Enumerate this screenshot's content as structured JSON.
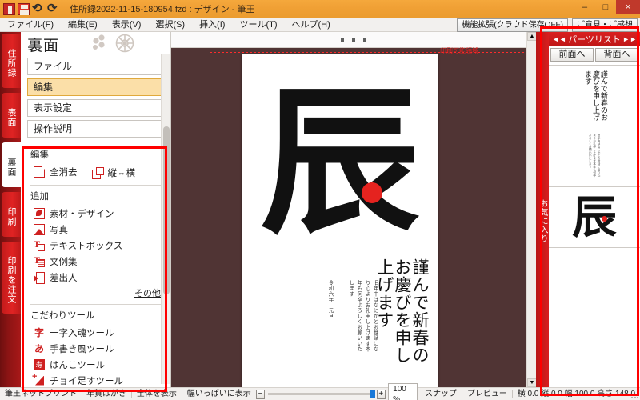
{
  "window": {
    "title": "住所録2022-11-15-180954.fzd : デザイン - 筆王",
    "icons": [
      "document-icon",
      "save-icon",
      "undo-icon",
      "redo-icon"
    ],
    "controls": {
      "minimize": "–",
      "maximize": "□",
      "close": "×"
    }
  },
  "menubar": {
    "items": [
      {
        "label": "ファイル(F)"
      },
      {
        "label": "編集(E)"
      },
      {
        "label": "表示(V)"
      },
      {
        "label": "選択(S)"
      },
      {
        "label": "挿入(I)"
      },
      {
        "label": "ツール(T)"
      },
      {
        "label": "ヘルプ(H)"
      }
    ],
    "right_buttons": [
      {
        "label": "機能拡張(クラウド保存OFF)"
      },
      {
        "label": "ご意見・ご感想"
      }
    ]
  },
  "rail": {
    "tabs": [
      {
        "label": "住所録",
        "active": false
      },
      {
        "label": "表面",
        "active": false
      },
      {
        "label": "裏面",
        "active": true
      },
      {
        "label": "印刷",
        "active": false
      },
      {
        "label": "印刷を注文",
        "active": false
      }
    ]
  },
  "left_panel": {
    "title": "裏面",
    "decoration": "plum-blossom-icon",
    "nav": [
      {
        "label": "ファイル",
        "active": false
      },
      {
        "label": "編集",
        "active": true
      },
      {
        "label": "表示設定",
        "active": false
      },
      {
        "label": "操作説明",
        "active": false
      }
    ],
    "sections": [
      {
        "title": "編集",
        "inline_tools": [
          {
            "label": "全消去",
            "icon": "erase-page-icon"
          },
          {
            "label": "縦⇔横",
            "icon": "flip-orientation-icon"
          }
        ]
      },
      {
        "title": "追加",
        "tools": [
          {
            "label": "素材・デザイン",
            "icon": "material-design-icon"
          },
          {
            "label": "写真",
            "icon": "photo-icon"
          },
          {
            "label": "テキストボックス",
            "icon": "textbox-icon"
          },
          {
            "label": "文例集",
            "icon": "text-sample-icon"
          },
          {
            "label": "差出人",
            "icon": "sender-icon"
          }
        ],
        "more_link": "その他"
      },
      {
        "title": "こだわりツール",
        "tools": [
          {
            "label": "一字入魂ツール",
            "icon": "single-char-tool-icon",
            "glyph": "字"
          },
          {
            "label": "手書き風ツール",
            "icon": "handwriting-tool-icon",
            "glyph": "あ"
          },
          {
            "label": "はんこツール",
            "icon": "stamp-tool-icon",
            "glyph": "寿"
          },
          {
            "label": "チョイ足すツール",
            "icon": "add-a-bit-tool-icon",
            "glyph": "+"
          }
        ]
      }
    ]
  },
  "canvas": {
    "printable_area_label": "印刷可能領域",
    "card": {
      "big_character": "辰",
      "greeting": "謹んで新春のお慶びを申し上げます",
      "body_text": "旧年中はなにかとお世話になり心よりお礼申し上げます本年も何卒よろしくお願いいたします",
      "date_text": "令和六年　元旦"
    }
  },
  "right_panel": {
    "favorites_label": "お気に入り",
    "title": "パーツリスト",
    "collapse_left_icon": "chevron-double-left-icon",
    "collapse_right_icon": "chevron-double-right-icon",
    "buttons": [
      {
        "label": "前面へ"
      },
      {
        "label": "背面へ"
      }
    ],
    "parts": [
      {
        "type": "text",
        "preview": "謹んで新春のお慶びを申し上げます"
      },
      {
        "type": "text",
        "preview": "旧年中はなにかとお世話になり心よりお礼申し上げます本年も何卒よろしくお願いいたします"
      },
      {
        "type": "image",
        "preview": "辰"
      },
      {
        "type": "empty",
        "preview": ""
      }
    ]
  },
  "statusbar": {
    "left_items": [
      "筆王ネットプリント",
      "年賀はがき"
    ],
    "view_items": [
      "全体を表示",
      "幅いっぱいに表示"
    ],
    "zoom_out": "−",
    "zoom_in": "+",
    "zoom_level": "100 %",
    "snap_label": "スナップ",
    "preview_label": "プレビュー",
    "coordinates": "横 0.0 縦 0.0  幅 100.0 高さ 148.0"
  }
}
